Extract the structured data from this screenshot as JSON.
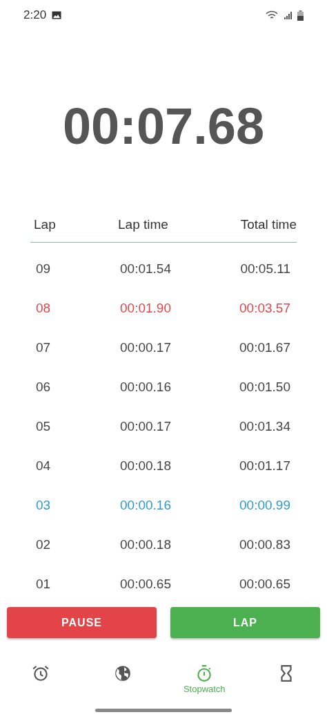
{
  "status_bar": {
    "time": "2:20"
  },
  "timer": "00:07.68",
  "table": {
    "columns": [
      "Lap",
      "Lap time",
      "Total time"
    ],
    "rows": [
      {
        "lap": "09",
        "lap_time": "00:01.54",
        "total_time": "00:05.11",
        "kind": "normal"
      },
      {
        "lap": "08",
        "lap_time": "00:01.90",
        "total_time": "00:03.57",
        "kind": "slowest"
      },
      {
        "lap": "07",
        "lap_time": "00:00.17",
        "total_time": "00:01.67",
        "kind": "normal"
      },
      {
        "lap": "06",
        "lap_time": "00:00.16",
        "total_time": "00:01.50",
        "kind": "normal"
      },
      {
        "lap": "05",
        "lap_time": "00:00.17",
        "total_time": "00:01.34",
        "kind": "normal"
      },
      {
        "lap": "04",
        "lap_time": "00:00.18",
        "total_time": "00:01.17",
        "kind": "normal"
      },
      {
        "lap": "03",
        "lap_time": "00:00.16",
        "total_time": "00:00.99",
        "kind": "fastest"
      },
      {
        "lap": "02",
        "lap_time": "00:00.18",
        "total_time": "00:00.83",
        "kind": "normal"
      },
      {
        "lap": "01",
        "lap_time": "00:00.65",
        "total_time": "00:00.65",
        "kind": "normal"
      }
    ]
  },
  "buttons": [
    {
      "label": "PAUSE",
      "kind": "pause"
    },
    {
      "label": "LAP",
      "kind": "lap"
    }
  ],
  "nav": [
    {
      "kind": "alarm",
      "selected": false
    },
    {
      "kind": "world",
      "selected": false
    },
    {
      "kind": "stopwatch",
      "label": "Stopwatch",
      "selected": true
    },
    {
      "kind": "timer",
      "selected": false
    }
  ]
}
